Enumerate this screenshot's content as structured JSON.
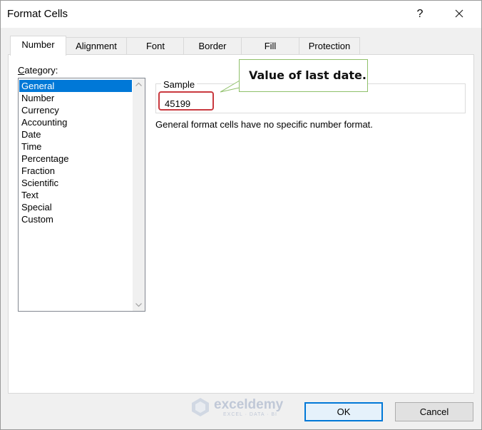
{
  "window": {
    "title": "Format Cells",
    "help": "?"
  },
  "tabs": [
    {
      "label": "Number",
      "active": true
    },
    {
      "label": "Alignment",
      "active": false
    },
    {
      "label": "Font",
      "active": false
    },
    {
      "label": "Border",
      "active": false
    },
    {
      "label": "Fill",
      "active": false
    },
    {
      "label": "Protection",
      "active": false
    }
  ],
  "category": {
    "label_first": "C",
    "label_rest": "ategory:",
    "items": [
      "General",
      "Number",
      "Currency",
      "Accounting",
      "Date",
      "Time",
      "Percentage",
      "Fraction",
      "Scientific",
      "Text",
      "Special",
      "Custom"
    ],
    "selected": "General"
  },
  "sample": {
    "legend": "Sample",
    "value": "45199"
  },
  "description": "General format cells have no specific number format.",
  "callout": {
    "text": "Value of last date."
  },
  "watermark": {
    "name": "exceldemy",
    "tagline": "EXCEL · DATA · BI"
  },
  "buttons": {
    "ok": "OK",
    "cancel": "Cancel"
  },
  "colors": {
    "selection": "#0078d7",
    "highlight": "#c9393f",
    "callout_border": "#8fc06a"
  }
}
